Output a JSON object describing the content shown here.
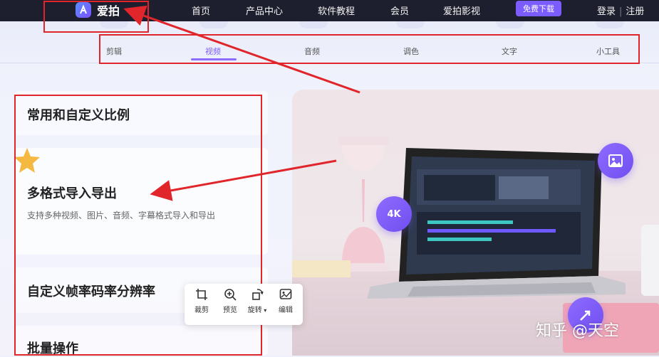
{
  "header": {
    "logo_text": "爱拍",
    "nav": [
      "首页",
      "产品中心",
      "软件教程",
      "会员",
      "爱拍影视"
    ],
    "download_label": "免费下载",
    "login_label": "登录",
    "divider": "|",
    "register_label": "注册"
  },
  "subtabs": {
    "items": [
      "剪辑",
      "视频",
      "音频",
      "调色",
      "文字",
      "小工具"
    ],
    "active": "视频"
  },
  "features": [
    {
      "title": "常用和自定义比例",
      "desc": ""
    },
    {
      "title": "多格式导入导出",
      "desc": "支持多种视频、图片、音频、字幕格式导入和导出"
    },
    {
      "title": "自定义帧率码率分辨率",
      "desc": ""
    },
    {
      "title": "批量操作",
      "desc": ""
    }
  ],
  "hero": {
    "badge_4k": "4K",
    "icons": [
      "image-icon",
      "share-icon"
    ]
  },
  "toolbar": {
    "items": [
      {
        "label": "裁剪",
        "icon": "crop-icon"
      },
      {
        "label": "预览",
        "icon": "zoom-in-icon"
      },
      {
        "label": "旋转",
        "icon": "rotate-icon"
      },
      {
        "label": "编辑",
        "icon": "edit-image-icon"
      }
    ]
  },
  "watermark": "知乎 @天空",
  "colors": {
    "accent": "#7b5cff",
    "topbar": "#1e1f2e",
    "annotation": "#e0262b"
  }
}
